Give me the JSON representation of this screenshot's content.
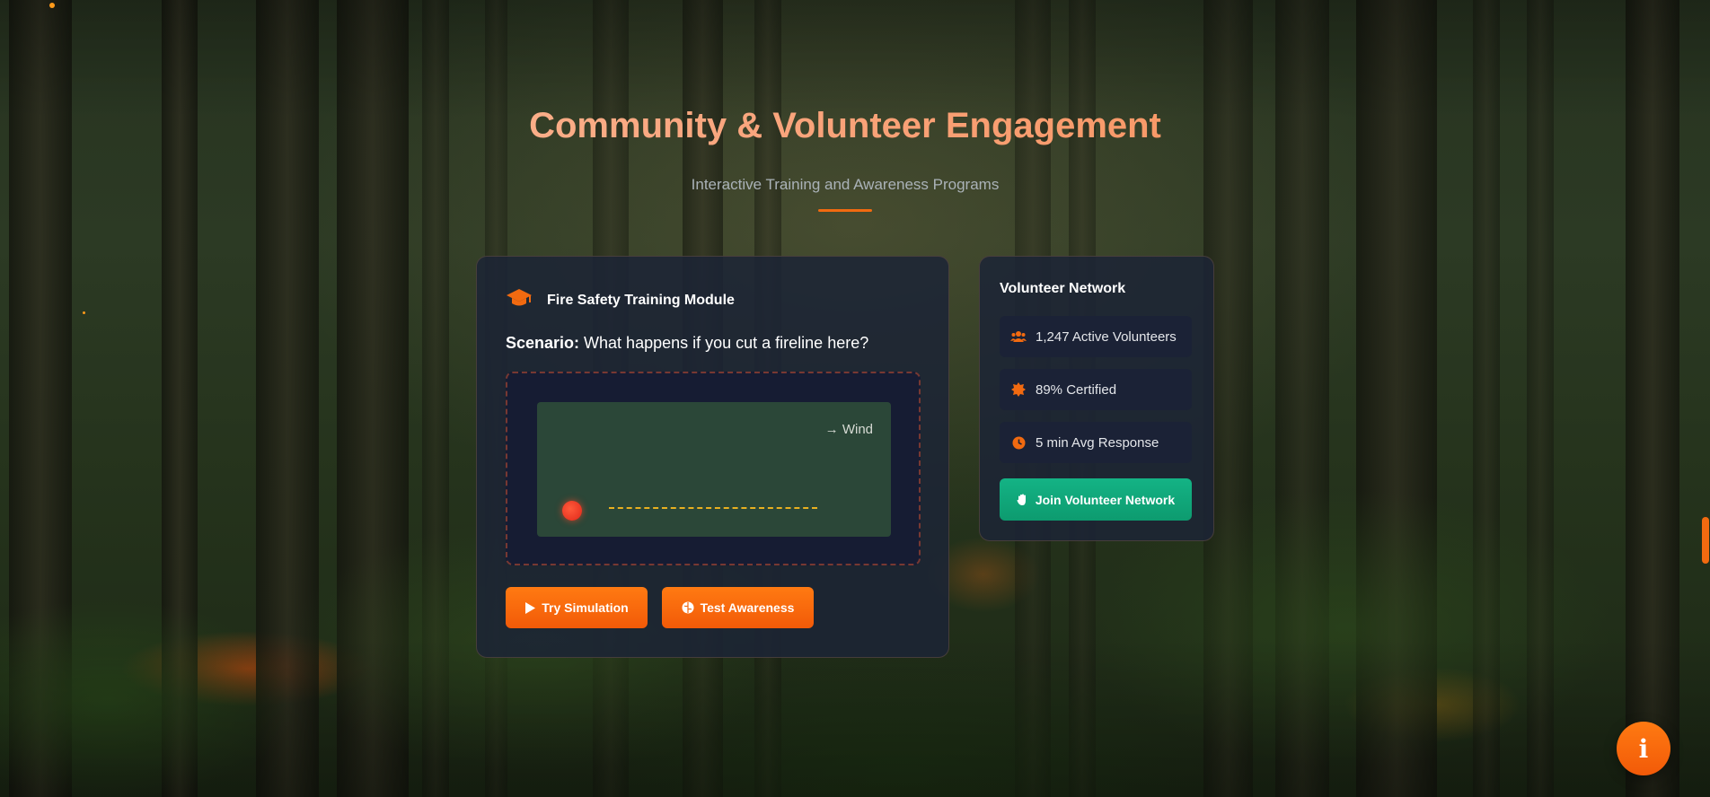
{
  "header": {
    "title": "Community & Volunteer Engagement",
    "subtitle": "Interactive Training and Awareness Programs"
  },
  "training": {
    "title": "Fire Safety Training Module",
    "icon": "graduation-cap-icon",
    "scenario_label": "Scenario:",
    "scenario_text": "What happens if you cut a fireline here?",
    "wind_label": "→ Wind",
    "buttons": {
      "simulation": "Try Simulation",
      "awareness": "Test Awareness"
    }
  },
  "volunteer": {
    "title": "Volunteer Network",
    "stats": [
      {
        "icon": "users-icon",
        "label": "1,247 Active Volunteers"
      },
      {
        "icon": "certificate-icon",
        "label": "89% Certified"
      },
      {
        "icon": "clock-icon",
        "label": "5 min Avg Response"
      }
    ],
    "join_label": "Join Volunteer Network"
  },
  "colors": {
    "accent": "#f26a10",
    "join_green": "#10a77a",
    "card_bg": "#1c2436"
  }
}
